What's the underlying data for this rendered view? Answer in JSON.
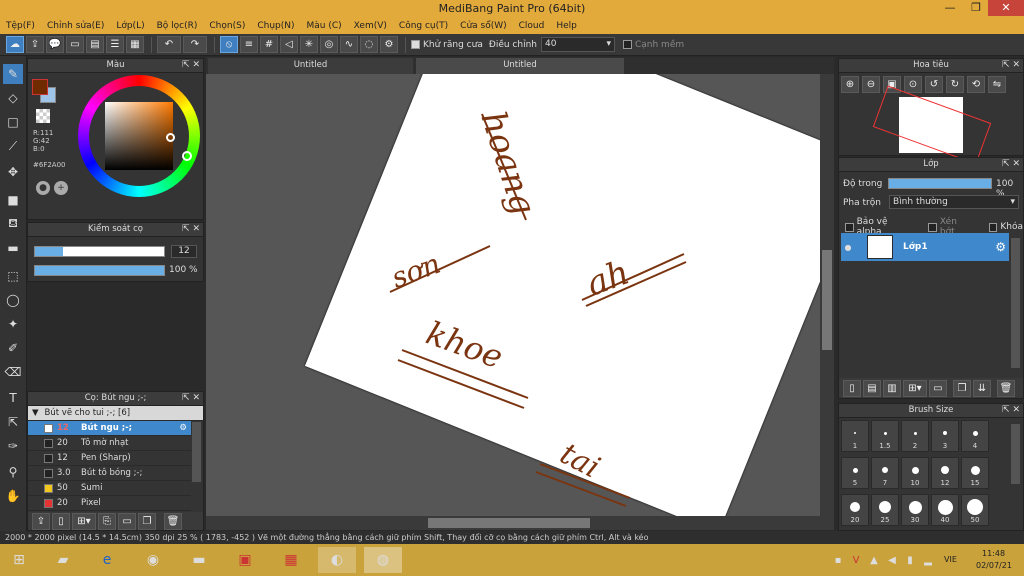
{
  "app": {
    "title": "MediBang Paint Pro (64bit)"
  },
  "window_buttons": {
    "min": "—",
    "max": "❐",
    "close": "✕"
  },
  "menu": [
    "Tệp(F)",
    "Chỉnh sửa(E)",
    "Lớp(L)",
    "Bộ lọc(R)",
    "Chọn(S)",
    "Chụp(N)",
    "Màu (C)",
    "Xem(V)",
    "Công cụ(T)",
    "Cửa sổ(W)",
    "Cloud",
    "Help"
  ],
  "toolbar": {
    "antialias_label": "Khử răng cưa",
    "antialias_checked": true,
    "adjust_label": "Điều chỉnh",
    "adjust_value": "40",
    "edge_label": "Cạnh mềm",
    "edge_checked": false
  },
  "color_panel": {
    "title": "Màu",
    "r": "R:111",
    "g": "G:42",
    "b": "B:0",
    "hex": "#6F2A00",
    "primary_color": "#6f2a00",
    "secondary_color": "#9ec4ea"
  },
  "brush_control": {
    "title": "Kiểm soát cọ",
    "size_value": "12",
    "opacity_value": "100 %",
    "size_fraction": 0.22,
    "opacity_fraction": 1.0
  },
  "brush_panel": {
    "title": "Cọ: Bút ngu ;-;",
    "group": "Bút vẽ cho tui ;-; [6]",
    "items": [
      {
        "size": "12",
        "name": "Bút ngu ;-;",
        "color": "#ffffff",
        "selected": true
      },
      {
        "size": "20",
        "name": "Tô mờ nhạt",
        "color": "#222222",
        "selected": false
      },
      {
        "size": "12",
        "name": "Pen (Sharp)",
        "color": "#222222",
        "selected": false
      },
      {
        "size": "3.0",
        "name": "Bút tô bóng ;-;",
        "color": "#222222",
        "selected": false
      },
      {
        "size": "50",
        "name": "Sumi",
        "color": "#f2c81c",
        "selected": false
      },
      {
        "size": "20",
        "name": "Pixel",
        "color": "#e33333",
        "selected": false
      }
    ]
  },
  "tabs": [
    "Untitled",
    "Untitled"
  ],
  "canvas_text": [
    "hoang",
    "sơn",
    "ah",
    "khoe",
    "tai"
  ],
  "navigator": {
    "title": "Hoa tiêu"
  },
  "layer_panel": {
    "title": "Lớp",
    "opacity_label": "Độ trong",
    "opacity_value": "100 %",
    "opacity_fraction": 1.0,
    "blend_label": "Pha trộn",
    "blend_value": "Bình thường",
    "protect_alpha": "Bảo vệ alpha",
    "clipping": "Xén bớt",
    "lock": "Khóa",
    "layer_name": "Lớp1"
  },
  "brush_size_panel": {
    "title": "Brush Size",
    "sizes": [
      "1",
      "1.5",
      "2",
      "3",
      "4",
      "5",
      "7",
      "10",
      "12",
      "15",
      "20",
      "25",
      "30",
      "40",
      "50"
    ]
  },
  "status": {
    "text": "2000 * 2000 pixel   (14.5 * 14.5cm)   350 dpi   25 %   ( 1783, -452 )   Vẽ một đường thẳng bằng cách giữ phím Shift, Thay đổi cỡ cọ bằng cách giữ phím Ctrl, Alt và kéo"
  },
  "taskbar": {
    "lang": "VIE",
    "time": "11:48",
    "date": "02/07/21"
  }
}
